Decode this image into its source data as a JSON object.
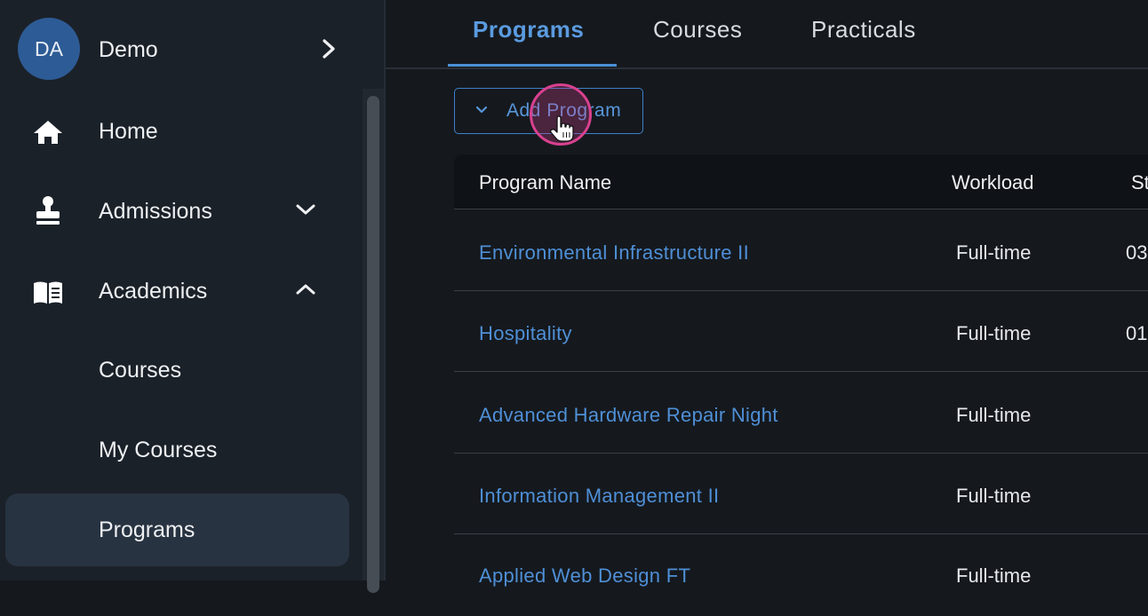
{
  "user": {
    "initials": "DA",
    "name": "Demo"
  },
  "sidebar": {
    "items": [
      {
        "label": "Home"
      },
      {
        "label": "Admissions"
      },
      {
        "label": "Academics"
      }
    ],
    "subitems": [
      {
        "label": "Courses"
      },
      {
        "label": "My Courses"
      },
      {
        "label": "Programs",
        "active": true
      }
    ]
  },
  "tabs": [
    {
      "label": "Programs",
      "active": true
    },
    {
      "label": "Courses"
    },
    {
      "label": "Practicals"
    }
  ],
  "actions": {
    "add_program": "Add Program"
  },
  "table": {
    "headers": [
      "Program Name",
      "Workload",
      "St"
    ],
    "rows": [
      {
        "name": "Environmental Infrastructure II",
        "workload": "Full-time",
        "start": "03"
      },
      {
        "name": "Hospitality",
        "workload": "Full-time",
        "start": "01"
      },
      {
        "name": "Advanced Hardware Repair Night",
        "workload": "Full-time",
        "start": ""
      },
      {
        "name": "Information Management II",
        "workload": "Full-time",
        "start": ""
      },
      {
        "name": "Applied Web Design FT",
        "workload": "Full-time",
        "start": ""
      }
    ]
  },
  "colors": {
    "accent": "#4f8fd6",
    "sidebar_bg": "#1b2129",
    "main_bg": "#15191e",
    "active_item_bg": "#283341",
    "click_indicator": "#d8418f"
  }
}
